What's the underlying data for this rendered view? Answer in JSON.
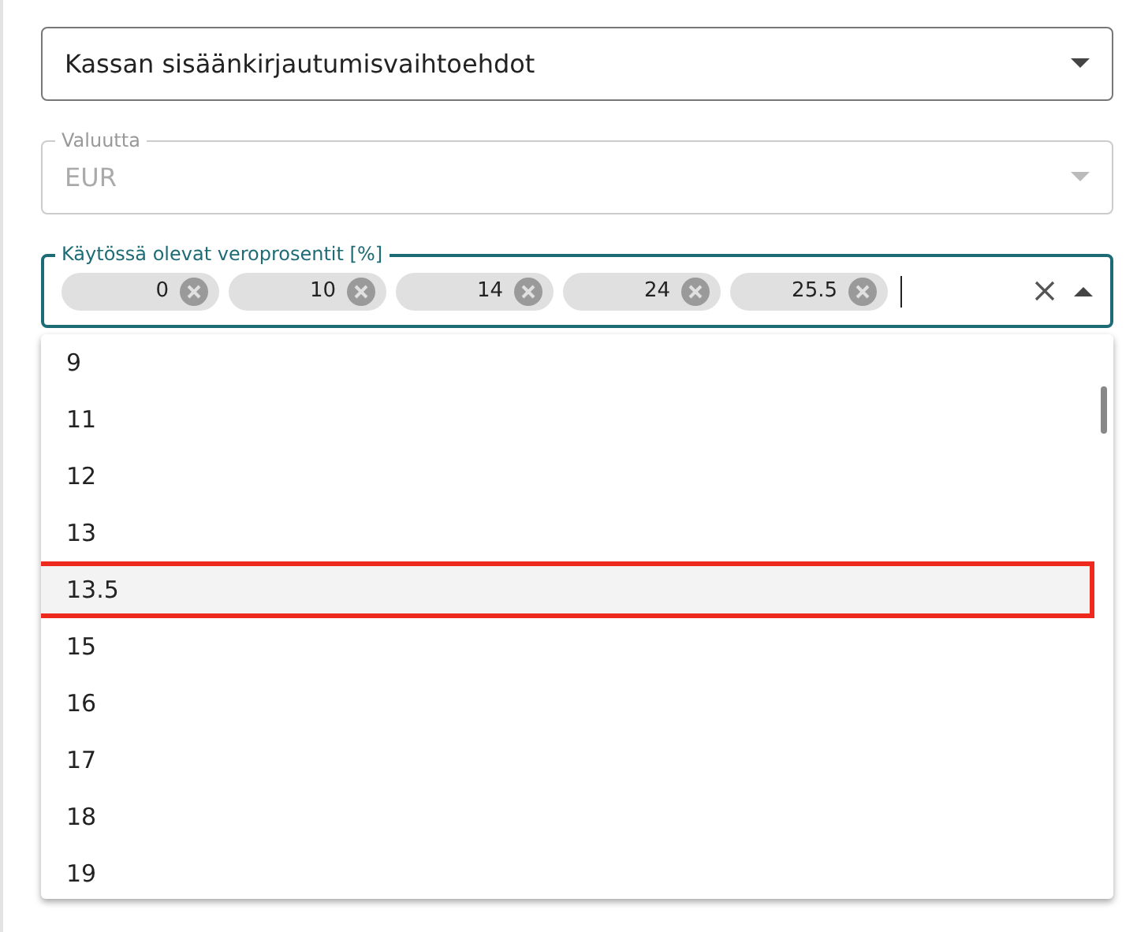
{
  "fields": [
    {
      "kind": "select",
      "value": "Kassan sisäänkirjautumisvaihtoehdot",
      "disabled": false,
      "focused": false
    },
    {
      "kind": "select",
      "label": "Valuutta",
      "value": "EUR",
      "disabled": true,
      "focused": false
    },
    {
      "kind": "chips",
      "label": "Käytössä olevat veroprosentit [%]",
      "disabled": false,
      "focused": true,
      "chips": [
        "0",
        "10",
        "14",
        "24",
        "25.5"
      ]
    }
  ],
  "dropdown": {
    "options": [
      {
        "label": "9",
        "selected": false
      },
      {
        "label": "11",
        "selected": false
      },
      {
        "label": "12",
        "selected": false
      },
      {
        "label": "13",
        "selected": false
      },
      {
        "label": "13.5",
        "selected": true
      },
      {
        "label": "15",
        "selected": false
      },
      {
        "label": "16",
        "selected": false
      },
      {
        "label": "17",
        "selected": false
      },
      {
        "label": "18",
        "selected": false
      },
      {
        "label": "19",
        "selected": false
      }
    ]
  }
}
